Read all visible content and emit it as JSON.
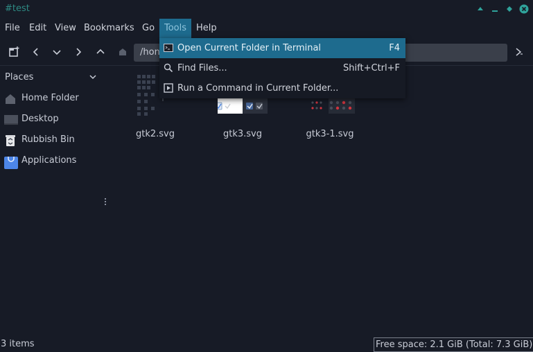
{
  "window": {
    "title": "#test"
  },
  "menubar": {
    "items": [
      {
        "label": "File"
      },
      {
        "label": "Edit"
      },
      {
        "label": "View"
      },
      {
        "label": "Bookmarks"
      },
      {
        "label": "Go"
      },
      {
        "label": "Tools"
      },
      {
        "label": "Help"
      }
    ]
  },
  "toolbar": {
    "location": "/hon"
  },
  "sidebar": {
    "header": "Places",
    "items": [
      {
        "label": "Home Folder",
        "icon": "home-folder-icon"
      },
      {
        "label": "Desktop",
        "icon": "desktop-icon"
      },
      {
        "label": "Rubbish Bin",
        "icon": "trash-icon"
      },
      {
        "label": "Applications",
        "icon": "applications-icon"
      }
    ]
  },
  "files": [
    {
      "name": "gtk2.svg"
    },
    {
      "name": "gtk3.svg"
    },
    {
      "name": "gtk3-1.svg"
    }
  ],
  "status": {
    "items": "3 items",
    "free_space": "Free space: 2.1 GiB (Total: 7.3 GiB)"
  },
  "tools_menu": {
    "items": [
      {
        "label": "Open Current Folder in Terminal",
        "shortcut": "F4",
        "icon": "terminal-icon"
      },
      {
        "label": "Find Files...",
        "shortcut": "Shift+Ctrl+F",
        "icon": "search-icon"
      },
      {
        "label": "Run a Command in Current Folder...",
        "shortcut": "",
        "icon": "run-command-icon"
      }
    ]
  },
  "colors": {
    "background": "#171b26",
    "accent": "#1e6b8e",
    "title": "#2e8b84",
    "window_button": "#2fa39b"
  }
}
